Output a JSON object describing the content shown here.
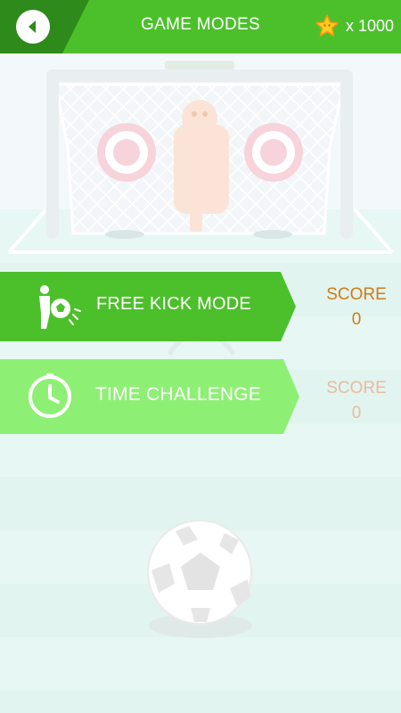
{
  "header": {
    "title": "GAME MODES",
    "coins_label": "x 1000"
  },
  "modes": [
    {
      "label": "FREE KICK MODE",
      "score_label": "SCORE",
      "score": "0"
    },
    {
      "label": "TIME CHALLENGE",
      "score_label": "SCORE",
      "score": "0"
    }
  ],
  "colors": {
    "header_green": "#4cc02b",
    "header_dark_green": "#2f8a1c",
    "active_mode": "#4cc02b",
    "inactive_mode": "#8df074",
    "score_active": "#cf7b16",
    "score_inactive": "#e9bba0"
  },
  "icons": [
    "back-arrow-icon",
    "star-coin-icon",
    "player-kicking-icon",
    "stopwatch-icon"
  ]
}
